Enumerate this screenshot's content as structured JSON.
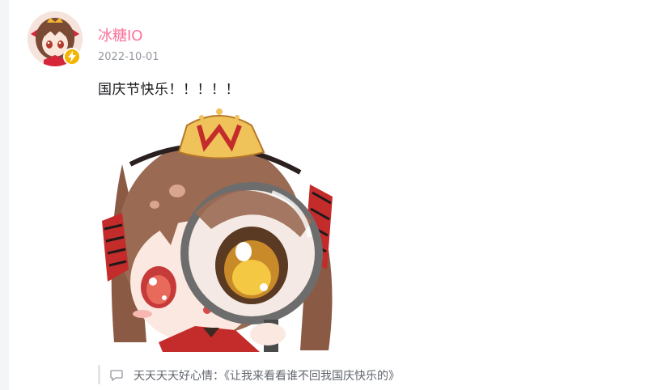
{
  "post": {
    "author": {
      "name": "冰糖IO",
      "name_color": "#fb7299",
      "badge_color": "#f5b400",
      "avatar_icon": "anime-girl-avatar",
      "badge_icon": "lightning-icon"
    },
    "date": "2022-10-01",
    "content": "国庆节快乐！！！！！",
    "image_icon": "anime-girl-magnifying-glass-illustration"
  },
  "comment": {
    "icon": "comment-bubble-icon",
    "user_label": "天天天天好心情：",
    "text": "《让我来看看谁不回我国庆快乐的》"
  }
}
